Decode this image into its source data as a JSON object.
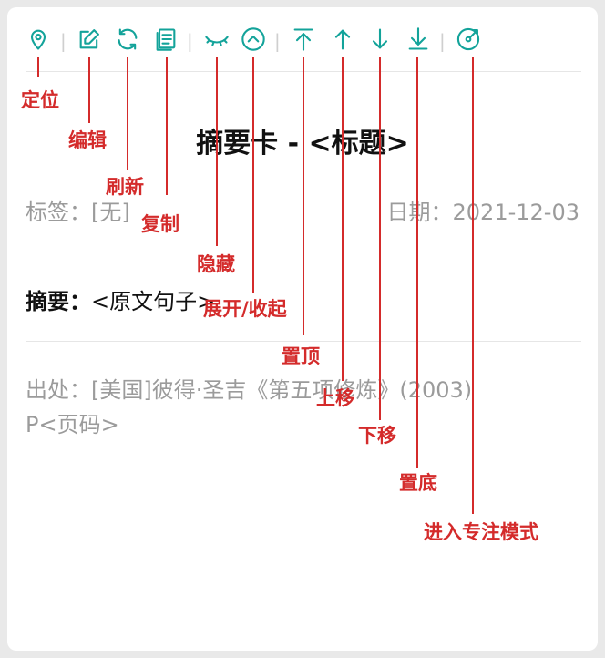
{
  "toolbar": {
    "icons": [
      {
        "name": "locate-icon",
        "label": "定位"
      },
      {
        "name": "edit-icon",
        "label": "编辑"
      },
      {
        "name": "refresh-icon",
        "label": "刷新"
      },
      {
        "name": "copy-icon",
        "label": "复制"
      },
      {
        "name": "hide-icon",
        "label": "隐藏"
      },
      {
        "name": "collapse-icon",
        "label": "展开/收起"
      },
      {
        "name": "top-icon",
        "label": "置顶"
      },
      {
        "name": "up-icon",
        "label": "上移"
      },
      {
        "name": "down-icon",
        "label": "下移"
      },
      {
        "name": "bottom-icon",
        "label": "置底"
      },
      {
        "name": "focus-mode-icon",
        "label": "进入专注模式"
      }
    ],
    "separator": "|"
  },
  "card": {
    "title": "摘要卡 - <标题>",
    "tags": "标签：[无]",
    "date": "日期：2021-12-03",
    "summary_label": "摘要：",
    "summary_text": "<原文句子>",
    "source_line1": "出处：[美国]彼得·圣吉《第五项修炼》(2003)",
    "source_line2": "P<页码>"
  },
  "colors": {
    "accent": "#13a39a",
    "annotation": "#d42b2b"
  }
}
